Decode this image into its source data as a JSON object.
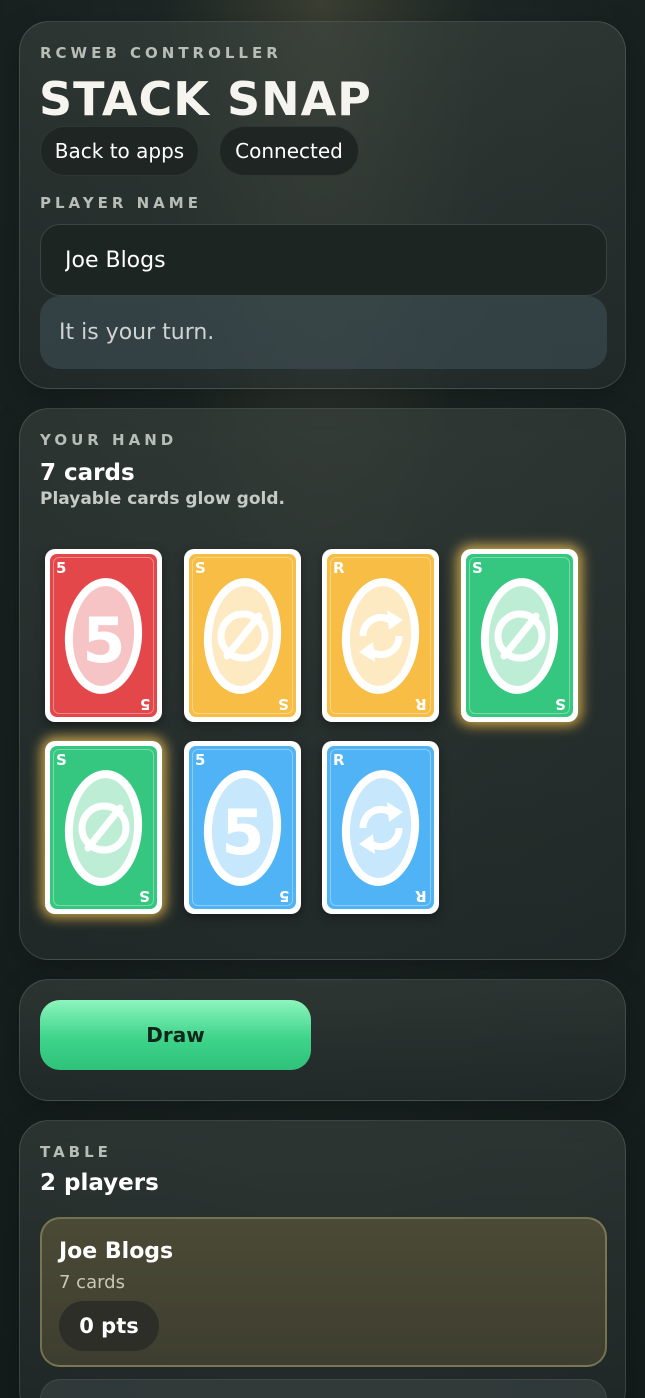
{
  "header": {
    "eyebrow": "RCWEB CONTROLLER",
    "title": "STACK SNAP",
    "back_label": "Back to apps",
    "connection_label": "Connected",
    "name_label": "PLAYER NAME",
    "name_value": "Joe Blogs",
    "status": "It is your turn."
  },
  "hand": {
    "eyebrow": "YOUR HAND",
    "count": "7 cards",
    "hint": "Playable cards glow gold.",
    "cards": [
      {
        "color": "red",
        "corner": "5",
        "symbol": "number-5",
        "playable": false
      },
      {
        "color": "yellow",
        "corner": "S",
        "symbol": "skip-icon",
        "playable": false
      },
      {
        "color": "yellow",
        "corner": "R",
        "symbol": "reverse-icon",
        "playable": false
      },
      {
        "color": "green",
        "corner": "S",
        "symbol": "skip-icon",
        "playable": true
      },
      {
        "color": "green",
        "corner": "S",
        "symbol": "skip-icon",
        "playable": true
      },
      {
        "color": "blue",
        "corner": "5",
        "symbol": "number-5",
        "playable": false
      },
      {
        "color": "blue",
        "corner": "R",
        "symbol": "reverse-icon",
        "playable": false
      }
    ]
  },
  "actions": {
    "draw_label": "Draw"
  },
  "table": {
    "eyebrow": "TABLE",
    "count": "2 players",
    "players": [
      {
        "name": "Joe Blogs",
        "cards": "7 cards",
        "points": "0 pts"
      }
    ]
  },
  "colors": {
    "red": "#e3474a",
    "yellow": "#f7bd44",
    "green": "#35c77f",
    "blue": "#4fb3f5",
    "draw_button": "#3ed48a",
    "playable_glow": "#ffcd5a"
  }
}
